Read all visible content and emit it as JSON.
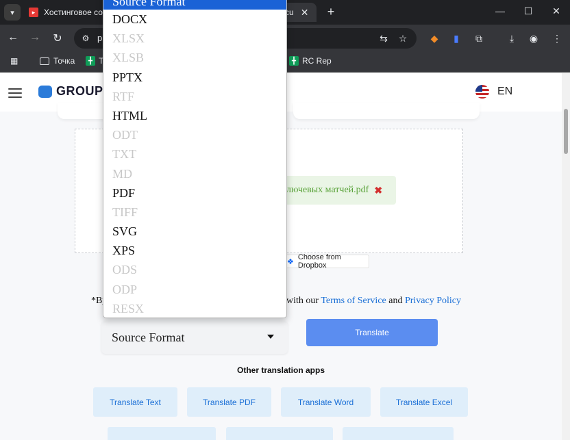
{
  "browser": {
    "tab_title": "Хостинговое сооб",
    "tab_title_fragment": "cu",
    "address_prefix": "p",
    "window_controls": [
      "—",
      "☐",
      "✕"
    ]
  },
  "bookmarks": [
    {
      "label": "Точка",
      "icon": "folder-icon"
    },
    {
      "label": "T",
      "icon": "sheets-icon"
    },
    {
      "label": "RC Rep",
      "icon": "sheets-icon"
    }
  ],
  "header": {
    "logo_text": "GROUPD",
    "language": "EN"
  },
  "upload": {
    "file_name": "лючевых матчей.pdf",
    "dropbox_label": "Choose from Dropbox"
  },
  "terms": {
    "prefix": "*By",
    "mid": "with our ",
    "tos": "Terms of Service",
    "and": " and ",
    "privacy": "Privacy Policy"
  },
  "form": {
    "select_label": "Source Format",
    "translate_label": "Translate"
  },
  "dropdown": {
    "options": [
      {
        "label": "Source Format",
        "state": "selected"
      },
      {
        "label": "DOCX",
        "state": "enabled"
      },
      {
        "label": "XLSX",
        "state": "disabled"
      },
      {
        "label": "XLSB",
        "state": "disabled"
      },
      {
        "label": "PPTX",
        "state": "enabled"
      },
      {
        "label": "RTF",
        "state": "disabled"
      },
      {
        "label": "HTML",
        "state": "enabled"
      },
      {
        "label": "ODT",
        "state": "disabled"
      },
      {
        "label": "TXT",
        "state": "disabled"
      },
      {
        "label": "MD",
        "state": "disabled"
      },
      {
        "label": "PDF",
        "state": "enabled"
      },
      {
        "label": "TIFF",
        "state": "disabled"
      },
      {
        "label": "SVG",
        "state": "enabled"
      },
      {
        "label": "XPS",
        "state": "enabled"
      },
      {
        "label": "ODS",
        "state": "disabled"
      },
      {
        "label": "ODP",
        "state": "disabled"
      },
      {
        "label": "RESX",
        "state": "disabled"
      }
    ]
  },
  "other_apps": {
    "title": "Other translation apps",
    "row1": [
      "Translate Text",
      "Translate PDF",
      "Translate Word",
      "Translate Excel"
    ]
  },
  "colors": {
    "accent_blue": "#5b8df0",
    "link_blue": "#1a6fd6",
    "selected_option": "#1a62d6",
    "file_green": "#5aa33a"
  }
}
